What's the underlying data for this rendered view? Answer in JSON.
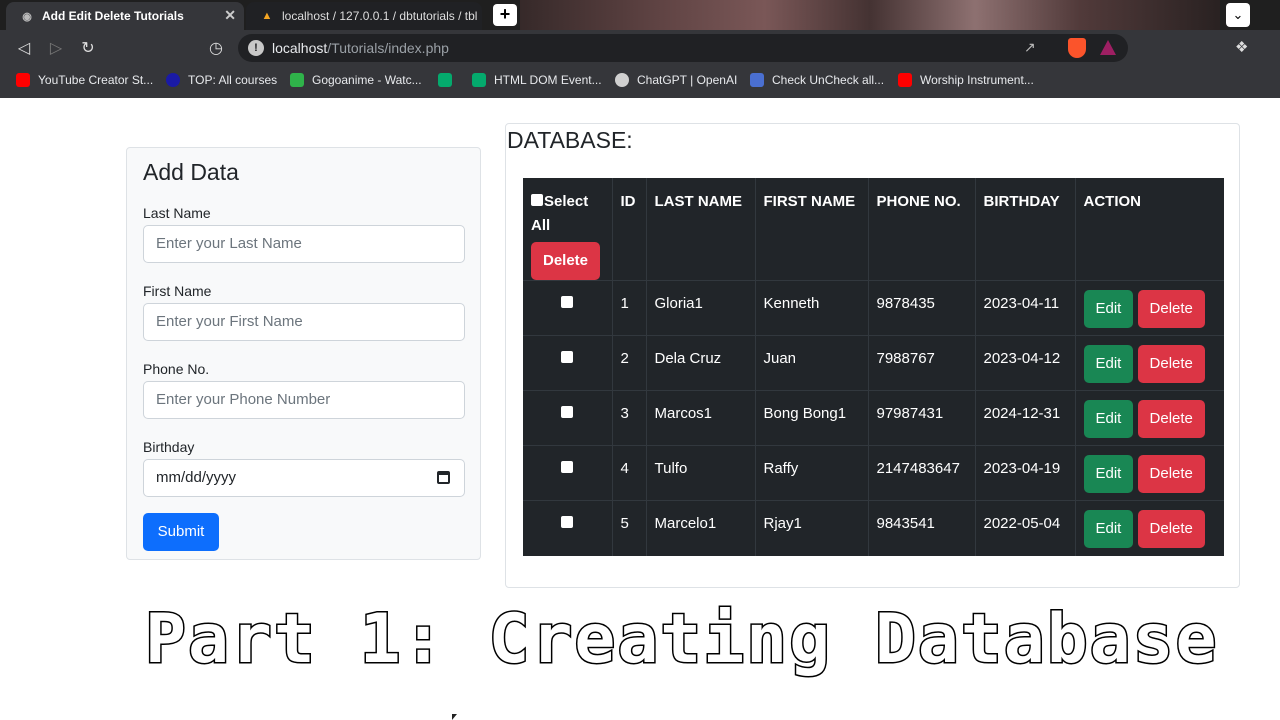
{
  "browser": {
    "tabs": [
      {
        "title": "Add Edit Delete Tutorials",
        "icon": "globe-icon",
        "active": true
      },
      {
        "title": "localhost / 127.0.0.1 / dbtutorials / tbl",
        "icon": "phpmyadmin-icon",
        "active": false
      }
    ],
    "new_tab_label": "+",
    "url_host": "localhost",
    "url_path": "/Tutorials/index.php",
    "bookmarks": [
      {
        "label": "YouTube Creator St...",
        "icon": "youtube-icon",
        "color": "#ff0000"
      },
      {
        "label": "TOP: All courses",
        "icon": "top-icon",
        "color": "#1a1aa6"
      },
      {
        "label": "Gogoanime - Watc...",
        "icon": "tv-icon",
        "color": "#2fb34a"
      },
      {
        "label": "",
        "icon": "w3-icon",
        "color": "#04aa6d"
      },
      {
        "label": "HTML DOM Event...",
        "icon": "w3-icon",
        "color": "#04aa6d"
      },
      {
        "label": "ChatGPT | OpenAI",
        "icon": "openai-icon",
        "color": "#d0d0d0"
      },
      {
        "label": "Check UnCheck all...",
        "icon": "generic-icon",
        "color": "#4a6fd1"
      },
      {
        "label": "Worship Instrument...",
        "icon": "youtube-icon",
        "color": "#ff0000"
      }
    ]
  },
  "form": {
    "title": "Add Data",
    "fields": [
      {
        "label": "Last Name",
        "placeholder": "Enter your Last Name"
      },
      {
        "label": "First Name",
        "placeholder": "Enter your First Name"
      },
      {
        "label": "Phone No.",
        "placeholder": "Enter your Phone Number"
      },
      {
        "label": "Birthday",
        "placeholder": "mm/dd/yyyy"
      }
    ],
    "submit_label": "Submit"
  },
  "database": {
    "title": "DATABASE:",
    "select_all_label": "Select All",
    "bulk_delete_label": "Delete",
    "columns": [
      "ID",
      "LAST NAME",
      "FIRST NAME",
      "PHONE NO.",
      "BIRTHDAY",
      "ACTION"
    ],
    "rows": [
      {
        "id": "1",
        "last": "Gloria1",
        "first": "Kenneth",
        "phone": "9878435",
        "birthday": "2023-04-11"
      },
      {
        "id": "2",
        "last": "Dela Cruz",
        "first": "Juan",
        "phone": "7988767",
        "birthday": "2023-04-12"
      },
      {
        "id": "3",
        "last": "Marcos1",
        "first": "Bong Bong1",
        "phone": "97987431",
        "birthday": "2024-12-31"
      },
      {
        "id": "4",
        "last": "Tulfo",
        "first": "Raffy",
        "phone": "2147483647",
        "birthday": "2023-04-19"
      },
      {
        "id": "5",
        "last": "Marcelo1",
        "first": "Rjay1",
        "phone": "9843541",
        "birthday": "2022-05-04"
      }
    ],
    "edit_label": "Edit",
    "delete_label": "Delete"
  },
  "overlay_text": "Part 1: Creating Database"
}
